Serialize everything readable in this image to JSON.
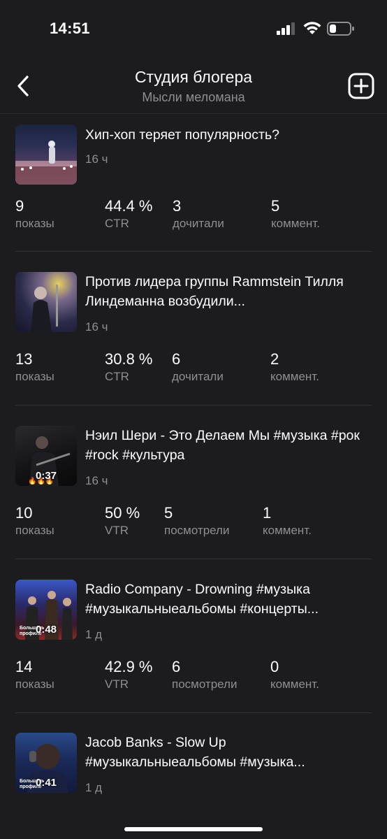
{
  "status_bar": {
    "time": "14:51"
  },
  "header": {
    "title": "Студия блогера",
    "subtitle": "Мысли меломана",
    "back_icon": "chevron-left-icon",
    "add_icon": "plus-square-icon"
  },
  "posts": [
    {
      "title": "Хип-хоп теряет популярность?",
      "age": "16 ч",
      "stats": [
        {
          "value": "9",
          "label": "показы"
        },
        {
          "value": "44.4 %",
          "label": "CTR"
        },
        {
          "value": "3",
          "label": "дочитали"
        },
        {
          "value": "5",
          "label": "коммент."
        }
      ]
    },
    {
      "title": "Против лидера группы Rammstein Тилля Линдеманна возбудили...",
      "age": "16 ч",
      "stats": [
        {
          "value": "13",
          "label": "показы"
        },
        {
          "value": "30.8 %",
          "label": "CTR"
        },
        {
          "value": "6",
          "label": "дочитали"
        },
        {
          "value": "2",
          "label": "коммент."
        }
      ]
    },
    {
      "title": "Нэил Шери - Это Делаем Мы #музыка #рок #rock #культура",
      "age": "16 ч",
      "duration": "0:37",
      "stats": [
        {
          "value": "10",
          "label": "показы"
        },
        {
          "value": "50 %",
          "label": "VTR"
        },
        {
          "value": "5",
          "label": "посмотрели"
        },
        {
          "value": "1",
          "label": "коммент."
        }
      ]
    },
    {
      "title": "Radio Company - Drowning #музыка #музыкальныеальбомы #концерты...",
      "age": "1 д",
      "duration": "0:48",
      "thumb_caption": "Больше в профиле",
      "stats": [
        {
          "value": "14",
          "label": "показы"
        },
        {
          "value": "42.9 %",
          "label": "VTR"
        },
        {
          "value": "6",
          "label": "посмотрели"
        },
        {
          "value": "0",
          "label": "коммент."
        }
      ]
    },
    {
      "title": "Jacob Banks - Slow Up #музыкальныеальбомы #музыка...",
      "age": "1 д",
      "duration": "0:41",
      "thumb_caption": "Больше в профиле"
    }
  ]
}
